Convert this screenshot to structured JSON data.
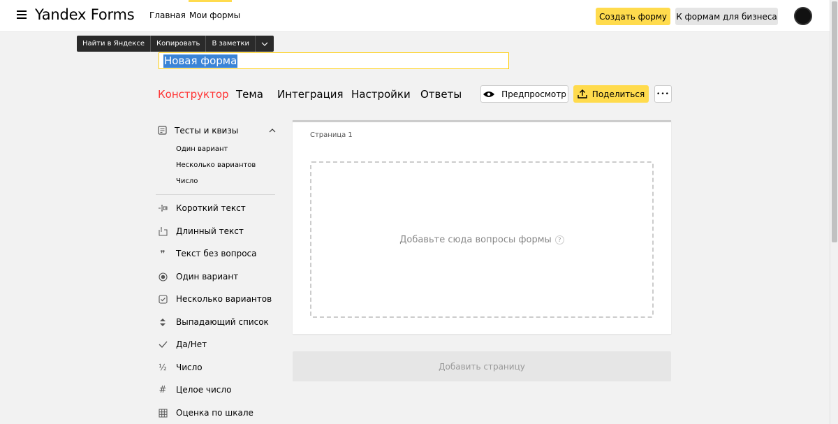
{
  "header": {
    "brand": "Yandex Forms",
    "nav": [
      {
        "label": "Главная"
      },
      {
        "label": "Мои формы"
      }
    ],
    "create_form": "Создать форму",
    "business": "К формам для бизнеса",
    "accent_color": "#ffdb4d"
  },
  "context_menu": {
    "items": [
      "Найти в Яндексе",
      "Копировать",
      "В заметки"
    ]
  },
  "form": {
    "title_value": "Новая форма"
  },
  "tabs": [
    {
      "label": "Конструктор",
      "active": true
    },
    {
      "label": "Тема"
    },
    {
      "label": "Интеграция"
    },
    {
      "label": "Настройки"
    },
    {
      "label": "Ответы"
    }
  ],
  "actions": {
    "preview": "Предпросмотр",
    "share": "Поделиться",
    "more": "•••"
  },
  "sidebar": {
    "section_title": "Тесты и квизы",
    "section_items": [
      "Один вариант",
      "Несколько вариантов",
      "Число"
    ],
    "items": [
      {
        "label": "Короткий текст",
        "icon": "short-text-icon"
      },
      {
        "label": "Длинный текст",
        "icon": "long-text-icon"
      },
      {
        "label": "Текст без вопроса",
        "icon": "quote-icon"
      },
      {
        "label": "Один вариант",
        "icon": "radio-icon"
      },
      {
        "label": "Несколько вариантов",
        "icon": "checkbox-icon"
      },
      {
        "label": "Выпадающий список",
        "icon": "dropdown-icon"
      },
      {
        "label": "Да/Нет",
        "icon": "check-icon"
      },
      {
        "label": "Число",
        "icon": "fraction-icon"
      },
      {
        "label": "Целое число",
        "icon": "hash-icon"
      },
      {
        "label": "Оценка по шкале",
        "icon": "grid-icon"
      }
    ]
  },
  "page": {
    "label": "Страница 1",
    "dropzone_text": "Добавьте сюда вопросы формы",
    "help": "?"
  },
  "add_page": "Добавить страницу"
}
